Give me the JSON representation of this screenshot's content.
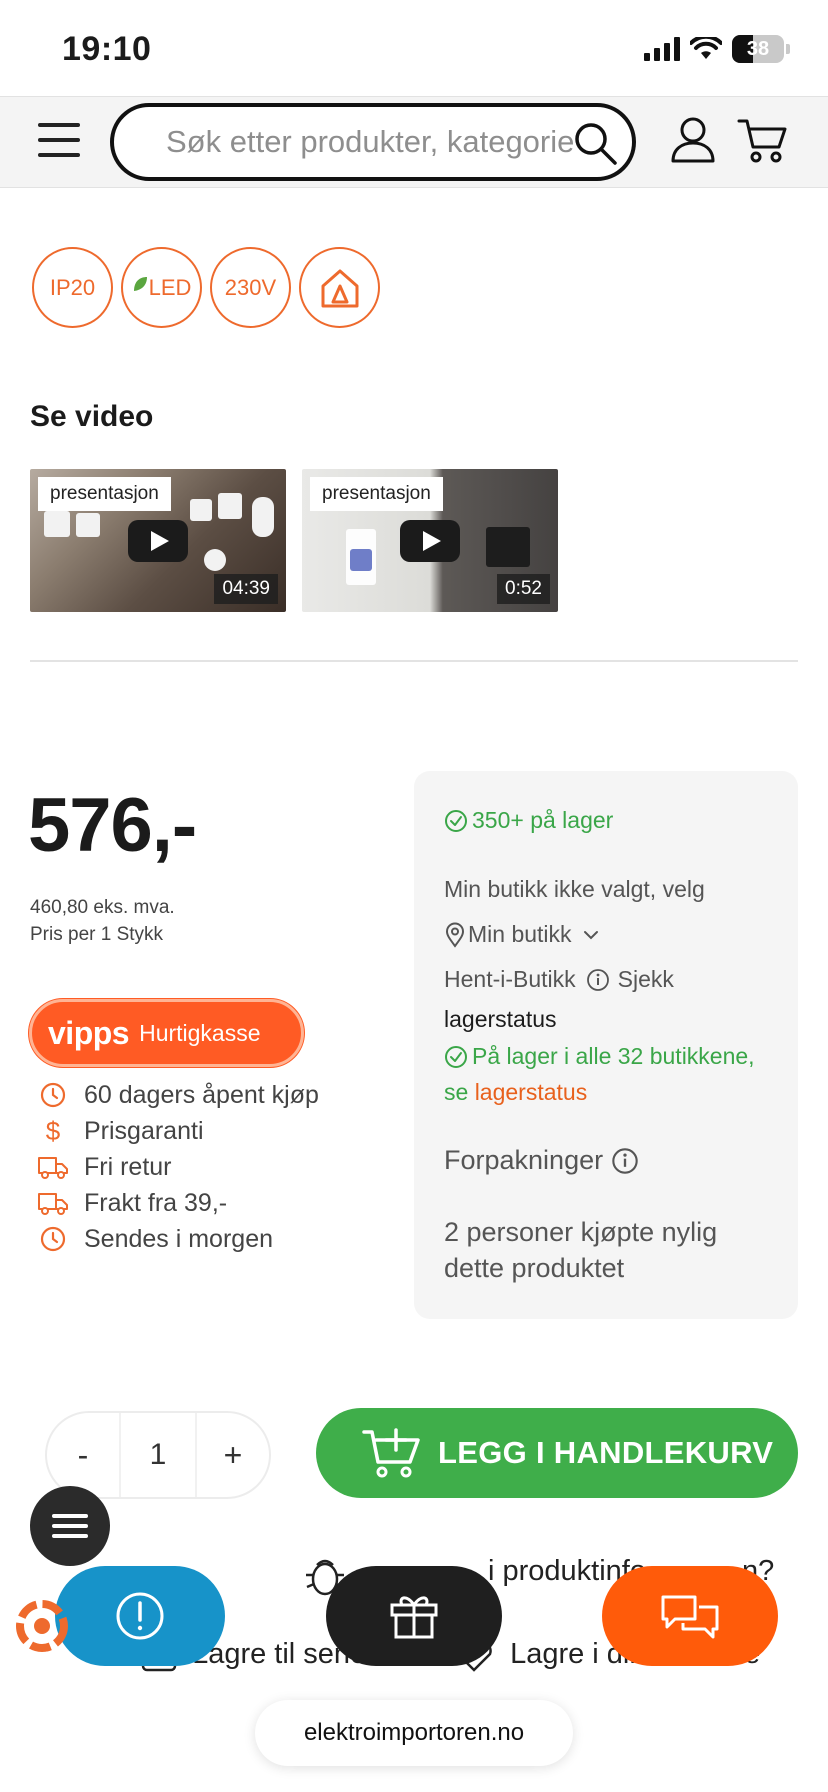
{
  "status_bar": {
    "time": "19:10",
    "battery": "38"
  },
  "header": {
    "search_placeholder": "Søk etter produkter, kategorier"
  },
  "badges": [
    "IP20",
    "LED",
    "230V"
  ],
  "video_section": {
    "title": "Se video",
    "videos": [
      {
        "tag": "presentasjon",
        "duration": "04:39"
      },
      {
        "tag": "presentasjon",
        "duration": "0:52"
      }
    ]
  },
  "price": {
    "amount": "576,-",
    "ex_vat": "460,80 eks. mva.",
    "per_unit": "Pris per 1 Stykk"
  },
  "vipps": {
    "logo": "vipps",
    "label": "Hurtigkasse"
  },
  "usps": [
    "60 dagers åpent kjøp",
    "Prisgaranti",
    "Fri retur",
    "Frakt fra 39,-",
    "Sendes i morgen"
  ],
  "stock": {
    "in_stock": "350+ på lager",
    "store_not_selected": "Min butikk ikke valgt, velg",
    "my_store": "Min butikk",
    "pickup": "Hent-i-Butikk",
    "check": "Sjekk",
    "stock_status": "lagerstatus",
    "all_stores": "På lager i alle 32 butikkene,",
    "see": "se",
    "stock_link": "lagerstatus",
    "packages": "Forpakninger",
    "recent_buyers_1": "2 personer kjøpte nylig",
    "recent_buyers_2": "dette produktet"
  },
  "cart": {
    "minus": "-",
    "quantity": "1",
    "plus": "+",
    "add_label": "LEGG I HANDLEKURV"
  },
  "below": {
    "error_report": "i produktinfo",
    "error_report_end": "n?",
    "save_later": "Lagre til sene",
    "save_list": "Lagre i din",
    "save_list_end": "te"
  },
  "browser": {
    "url": "elektroimportoren.no"
  },
  "colors": {
    "brand_orange": "#ee6a2d",
    "green": "#3fae4a",
    "vipps": "#ff5b24",
    "info_blue": "#1793c9"
  }
}
